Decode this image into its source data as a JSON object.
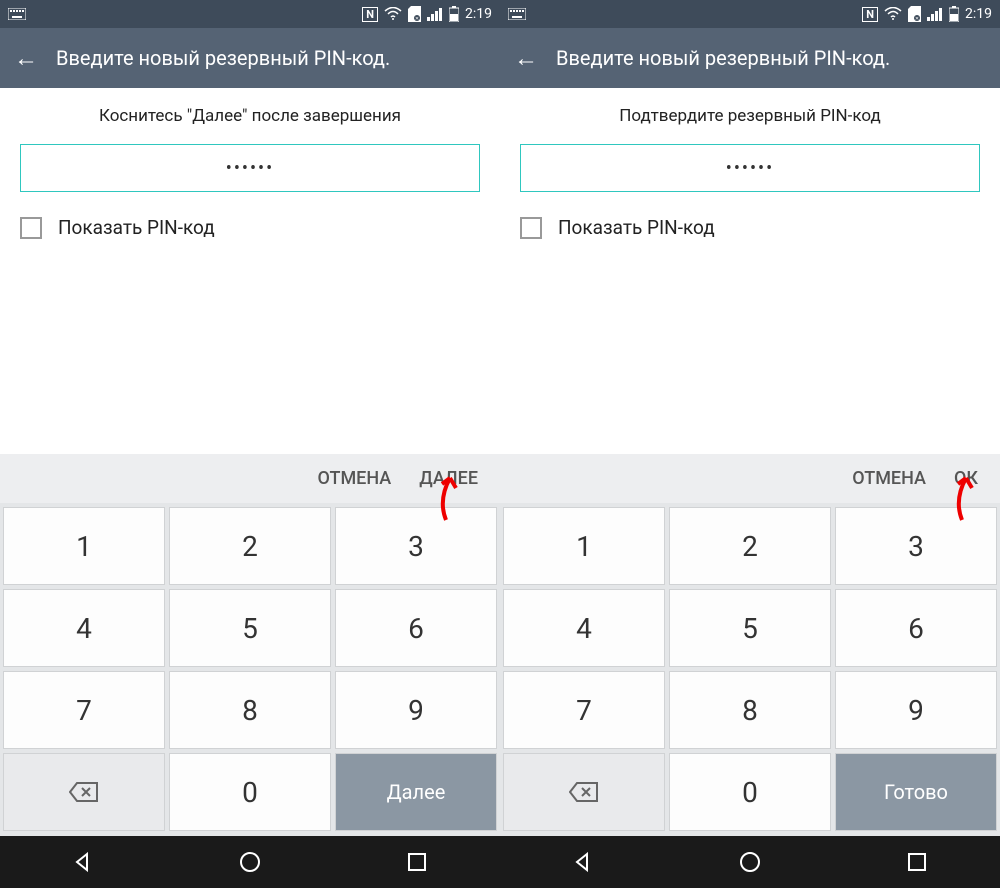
{
  "status": {
    "time": "2:19",
    "icons": {
      "keyboard": "keyboard-icon",
      "nfc": "N",
      "wifi": "wifi-icon",
      "sd": "sd-icon",
      "signal": "signal-icon",
      "battery": "battery-icon"
    }
  },
  "screens": [
    {
      "title": "Введите новый резервный PIN-код.",
      "instruction": "Коснитесь \"Далее\" после завершения",
      "pin_masked": "••••••",
      "show_pin_label": "Показать PIN-код",
      "cancel_label": "ОТМЕНА",
      "confirm_label": "ДАЛЕЕ",
      "keypad": {
        "rows": [
          [
            "1",
            "2",
            "3"
          ],
          [
            "4",
            "5",
            "6"
          ],
          [
            "7",
            "8",
            "9"
          ]
        ],
        "bottom": {
          "backspace": "⌫",
          "zero": "0",
          "action": "Далее"
        }
      }
    },
    {
      "title": "Введите новый резервный PIN-код.",
      "instruction": "Подтвердите резервный PIN-код",
      "pin_masked": "••••••",
      "show_pin_label": "Показать PIN-код",
      "cancel_label": "ОТМЕНА",
      "confirm_label": "ОК",
      "keypad": {
        "rows": [
          [
            "1",
            "2",
            "3"
          ],
          [
            "4",
            "5",
            "6"
          ],
          [
            "7",
            "8",
            "9"
          ]
        ],
        "bottom": {
          "backspace": "⌫",
          "zero": "0",
          "action": "Готово"
        }
      }
    }
  ]
}
